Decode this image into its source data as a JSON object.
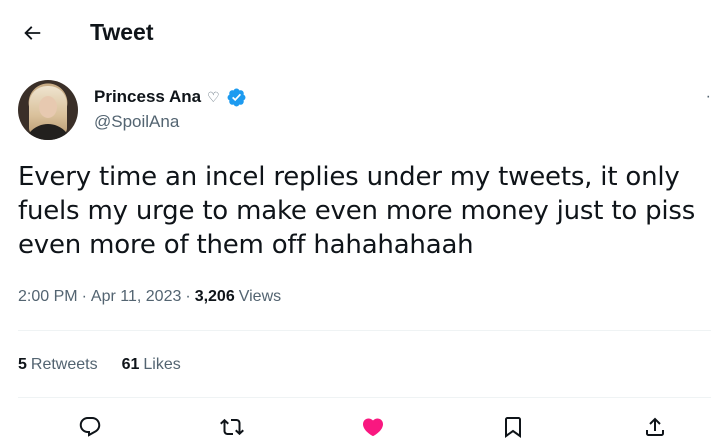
{
  "header": {
    "title": "Tweet",
    "back_icon": "arrow-left-icon"
  },
  "author": {
    "display_name": "Princess Ana",
    "name_symbol": "♡",
    "handle": "@SpoilAna",
    "verified_color": "#1d9bf0"
  },
  "tweet": {
    "text": "Every time an incel replies under my tweets, it only fuels my urge to make even more money just to piss even more of them off hahahahaah",
    "time": "2:00 PM",
    "date": "Apr 11, 2023",
    "views_count": "3,206",
    "views_label": "Views",
    "separator": "·"
  },
  "stats": {
    "retweets_count": "5",
    "retweets_label": "Retweets",
    "likes_count": "61",
    "likes_label": "Likes"
  },
  "actions": {
    "reply_icon": "reply-icon",
    "retweet_icon": "retweet-icon",
    "like_icon": "heart-filled-icon",
    "bookmark_icon": "bookmark-icon",
    "share_icon": "share-icon",
    "like_color": "#f91880"
  }
}
